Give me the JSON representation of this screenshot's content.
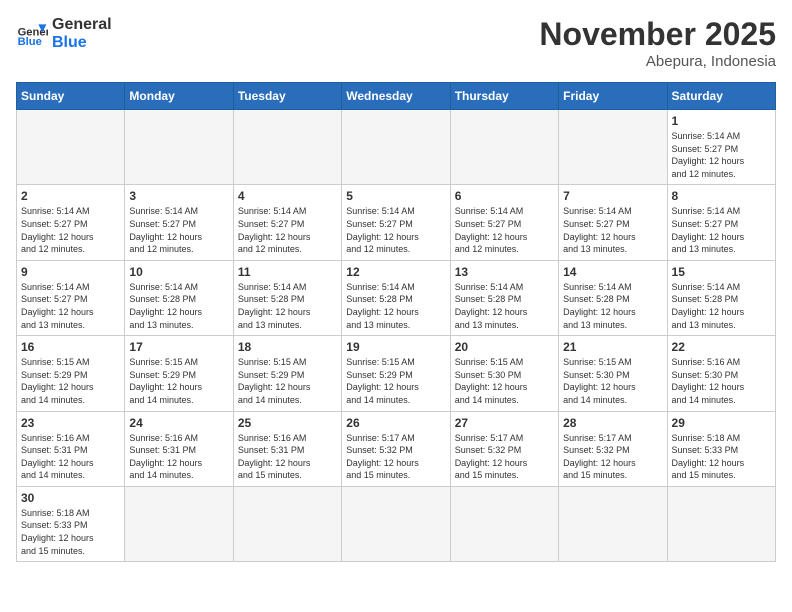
{
  "logo": {
    "text_general": "General",
    "text_blue": "Blue"
  },
  "title": "November 2025",
  "subtitle": "Abepura, Indonesia",
  "days_of_week": [
    "Sunday",
    "Monday",
    "Tuesday",
    "Wednesday",
    "Thursday",
    "Friday",
    "Saturday"
  ],
  "weeks": [
    [
      {
        "day": "",
        "info": ""
      },
      {
        "day": "",
        "info": ""
      },
      {
        "day": "",
        "info": ""
      },
      {
        "day": "",
        "info": ""
      },
      {
        "day": "",
        "info": ""
      },
      {
        "day": "",
        "info": ""
      },
      {
        "day": "1",
        "info": "Sunrise: 5:14 AM\nSunset: 5:27 PM\nDaylight: 12 hours\nand 12 minutes."
      }
    ],
    [
      {
        "day": "2",
        "info": "Sunrise: 5:14 AM\nSunset: 5:27 PM\nDaylight: 12 hours\nand 12 minutes."
      },
      {
        "day": "3",
        "info": "Sunrise: 5:14 AM\nSunset: 5:27 PM\nDaylight: 12 hours\nand 12 minutes."
      },
      {
        "day": "4",
        "info": "Sunrise: 5:14 AM\nSunset: 5:27 PM\nDaylight: 12 hours\nand 12 minutes."
      },
      {
        "day": "5",
        "info": "Sunrise: 5:14 AM\nSunset: 5:27 PM\nDaylight: 12 hours\nand 12 minutes."
      },
      {
        "day": "6",
        "info": "Sunrise: 5:14 AM\nSunset: 5:27 PM\nDaylight: 12 hours\nand 12 minutes."
      },
      {
        "day": "7",
        "info": "Sunrise: 5:14 AM\nSunset: 5:27 PM\nDaylight: 12 hours\nand 13 minutes."
      },
      {
        "day": "8",
        "info": "Sunrise: 5:14 AM\nSunset: 5:27 PM\nDaylight: 12 hours\nand 13 minutes."
      }
    ],
    [
      {
        "day": "9",
        "info": "Sunrise: 5:14 AM\nSunset: 5:27 PM\nDaylight: 12 hours\nand 13 minutes."
      },
      {
        "day": "10",
        "info": "Sunrise: 5:14 AM\nSunset: 5:28 PM\nDaylight: 12 hours\nand 13 minutes."
      },
      {
        "day": "11",
        "info": "Sunrise: 5:14 AM\nSunset: 5:28 PM\nDaylight: 12 hours\nand 13 minutes."
      },
      {
        "day": "12",
        "info": "Sunrise: 5:14 AM\nSunset: 5:28 PM\nDaylight: 12 hours\nand 13 minutes."
      },
      {
        "day": "13",
        "info": "Sunrise: 5:14 AM\nSunset: 5:28 PM\nDaylight: 12 hours\nand 13 minutes."
      },
      {
        "day": "14",
        "info": "Sunrise: 5:14 AM\nSunset: 5:28 PM\nDaylight: 12 hours\nand 13 minutes."
      },
      {
        "day": "15",
        "info": "Sunrise: 5:14 AM\nSunset: 5:28 PM\nDaylight: 12 hours\nand 13 minutes."
      }
    ],
    [
      {
        "day": "16",
        "info": "Sunrise: 5:15 AM\nSunset: 5:29 PM\nDaylight: 12 hours\nand 14 minutes."
      },
      {
        "day": "17",
        "info": "Sunrise: 5:15 AM\nSunset: 5:29 PM\nDaylight: 12 hours\nand 14 minutes."
      },
      {
        "day": "18",
        "info": "Sunrise: 5:15 AM\nSunset: 5:29 PM\nDaylight: 12 hours\nand 14 minutes."
      },
      {
        "day": "19",
        "info": "Sunrise: 5:15 AM\nSunset: 5:29 PM\nDaylight: 12 hours\nand 14 minutes."
      },
      {
        "day": "20",
        "info": "Sunrise: 5:15 AM\nSunset: 5:30 PM\nDaylight: 12 hours\nand 14 minutes."
      },
      {
        "day": "21",
        "info": "Sunrise: 5:15 AM\nSunset: 5:30 PM\nDaylight: 12 hours\nand 14 minutes."
      },
      {
        "day": "22",
        "info": "Sunrise: 5:16 AM\nSunset: 5:30 PM\nDaylight: 12 hours\nand 14 minutes."
      }
    ],
    [
      {
        "day": "23",
        "info": "Sunrise: 5:16 AM\nSunset: 5:31 PM\nDaylight: 12 hours\nand 14 minutes."
      },
      {
        "day": "24",
        "info": "Sunrise: 5:16 AM\nSunset: 5:31 PM\nDaylight: 12 hours\nand 14 minutes."
      },
      {
        "day": "25",
        "info": "Sunrise: 5:16 AM\nSunset: 5:31 PM\nDaylight: 12 hours\nand 15 minutes."
      },
      {
        "day": "26",
        "info": "Sunrise: 5:17 AM\nSunset: 5:32 PM\nDaylight: 12 hours\nand 15 minutes."
      },
      {
        "day": "27",
        "info": "Sunrise: 5:17 AM\nSunset: 5:32 PM\nDaylight: 12 hours\nand 15 minutes."
      },
      {
        "day": "28",
        "info": "Sunrise: 5:17 AM\nSunset: 5:32 PM\nDaylight: 12 hours\nand 15 minutes."
      },
      {
        "day": "29",
        "info": "Sunrise: 5:18 AM\nSunset: 5:33 PM\nDaylight: 12 hours\nand 15 minutes."
      }
    ],
    [
      {
        "day": "30",
        "info": "Sunrise: 5:18 AM\nSunset: 5:33 PM\nDaylight: 12 hours\nand 15 minutes."
      },
      {
        "day": "",
        "info": ""
      },
      {
        "day": "",
        "info": ""
      },
      {
        "day": "",
        "info": ""
      },
      {
        "day": "",
        "info": ""
      },
      {
        "day": "",
        "info": ""
      },
      {
        "day": "",
        "info": ""
      }
    ]
  ]
}
